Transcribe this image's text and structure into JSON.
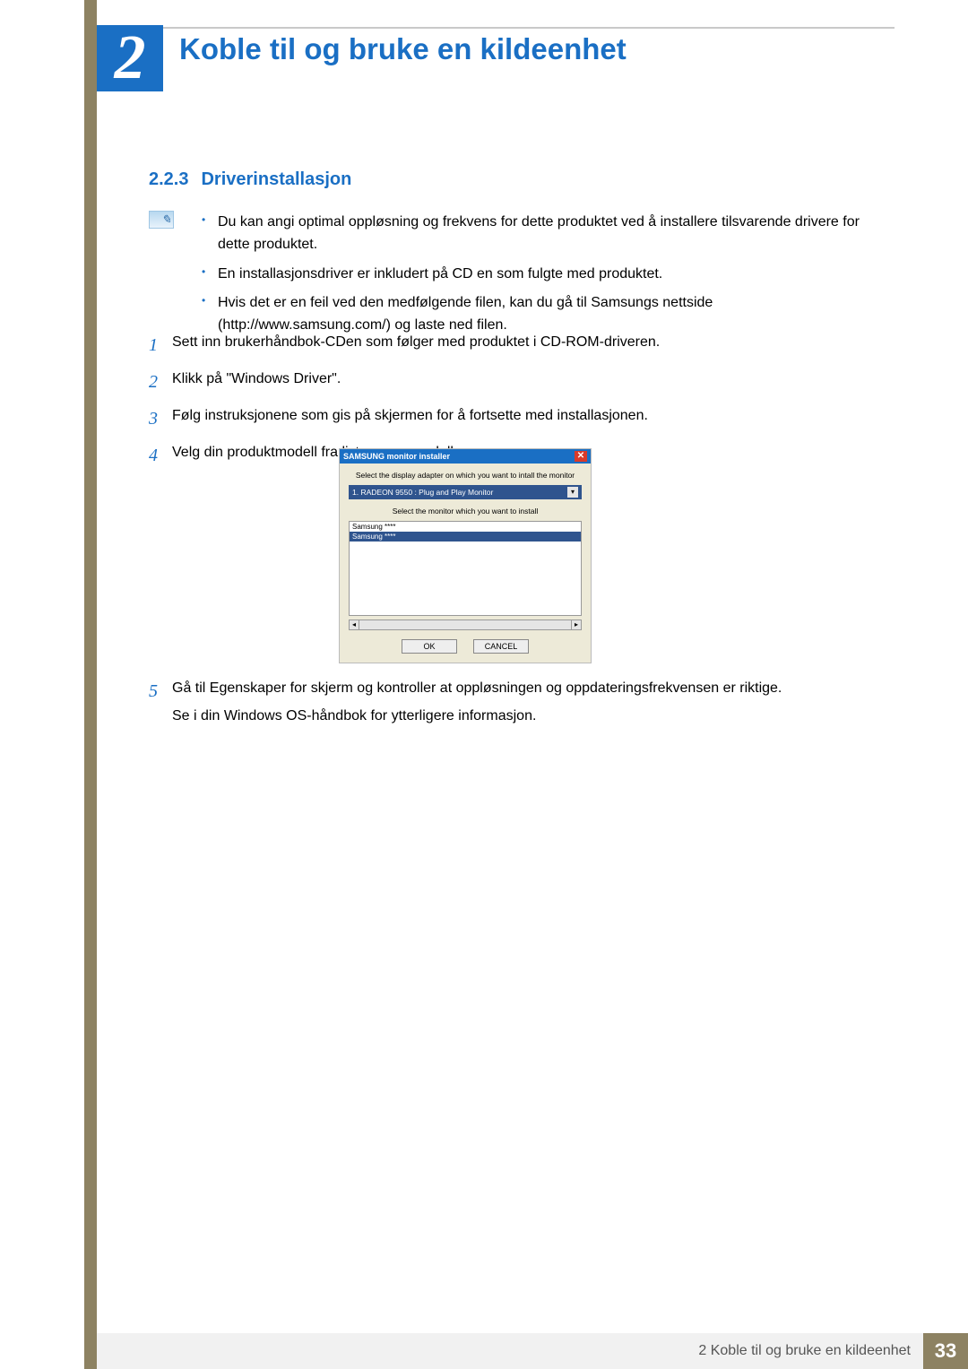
{
  "chapter": {
    "number": "2",
    "title": "Koble til og bruke en kildeenhet"
  },
  "section": {
    "number": "2.2.3",
    "title": "Driverinstallasjon"
  },
  "bullets": [
    "Du kan angi optimal oppløsning og frekvens for dette produktet ved å installere tilsvarende drivere for dette produktet.",
    "En installasjonsdriver er inkludert på CD en som fulgte med produktet.",
    "Hvis det er en feil ved den medfølgende filen, kan du gå til Samsungs nettside (http://www.samsung.com/) og laste ned filen."
  ],
  "steps": [
    {
      "n": "1",
      "text": "Sett inn brukerhåndbok-CDen som følger med produktet i CD-ROM-driveren."
    },
    {
      "n": "2",
      "text": "Klikk på \"Windows Driver\"."
    },
    {
      "n": "3",
      "text": "Følg instruksjonene som gis på skjermen for å fortsette med installasjonen."
    },
    {
      "n": "4",
      "text": "Velg din produktmodell fra listen over modeller."
    }
  ],
  "step5": {
    "n": "5",
    "line1": "Gå til Egenskaper for skjerm og kontroller at oppløsningen og oppdateringsfrekvensen er riktige.",
    "line2": "Se i din Windows OS-håndbok for ytterligere informasjon."
  },
  "installer": {
    "title": "SAMSUNG monitor installer",
    "label1": "Select the display adapter on which you want to intall the monitor",
    "combo_value": "1. RADEON 9550 : Plug and Play Monitor",
    "label2": "Select the monitor which you want to install",
    "list_item1": "Samsung ****",
    "list_item2": "Samsung ****",
    "ok": "OK",
    "cancel": "CANCEL"
  },
  "footer": {
    "chapter_ref": "2 Koble til og bruke en kildeenhet",
    "page": "33"
  }
}
